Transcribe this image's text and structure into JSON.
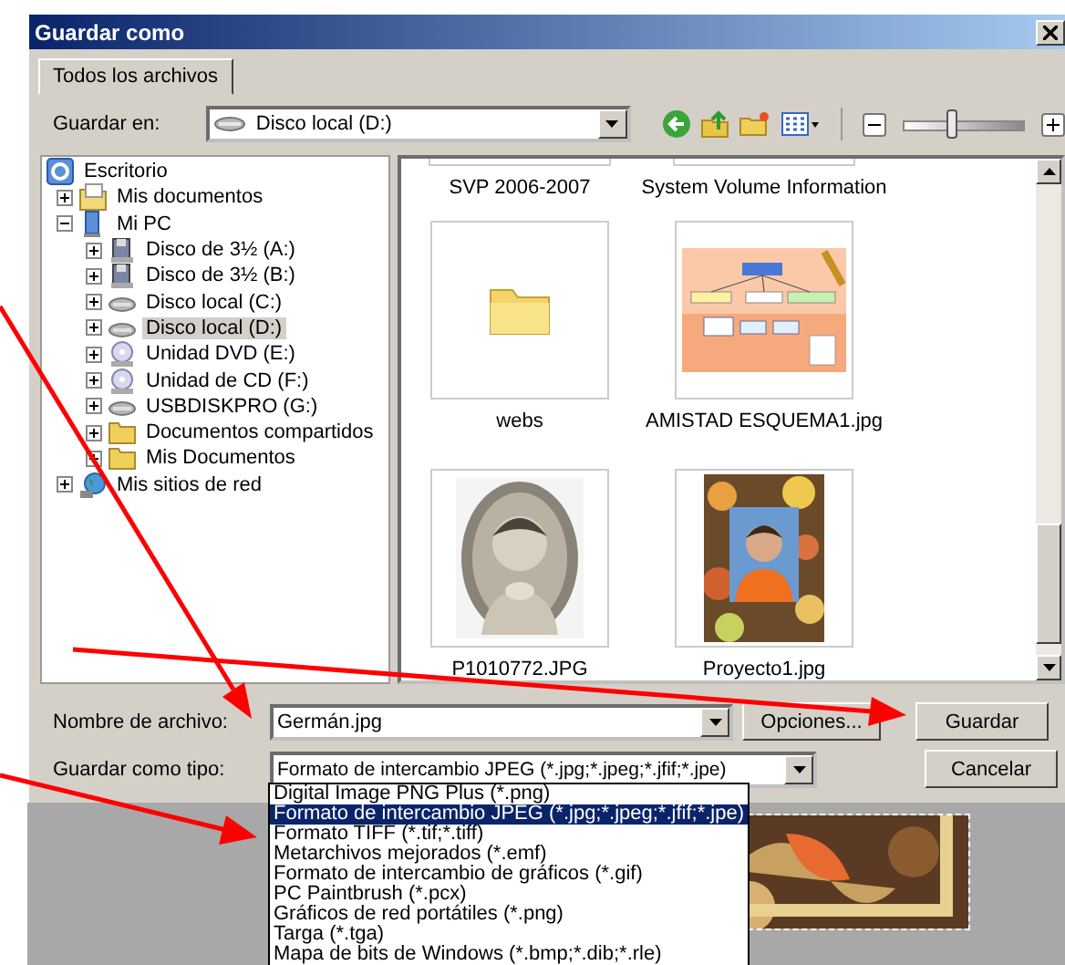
{
  "window": {
    "title": "Guardar como"
  },
  "tabs": [
    {
      "label": "Todos los archivos",
      "selected": true
    }
  ],
  "toolbar": {
    "label": "Guardar en:",
    "location": "Disco local (D:)",
    "zoom": {
      "level": 0.4
    }
  },
  "tree": {
    "root": {
      "label": "Escritorio",
      "kind": "desktop",
      "selected": false,
      "children": [
        {
          "label": "Mis documentos",
          "kind": "documents",
          "expanded": false,
          "selected": false
        },
        {
          "label": "Mi PC",
          "kind": "computer",
          "expanded": true,
          "selected": false,
          "children": [
            {
              "label": "Disco de 3½ (A:)",
              "kind": "floppy",
              "expanded": false,
              "selected": false
            },
            {
              "label": "Disco de 3½ (B:)",
              "kind": "floppy",
              "expanded": false,
              "selected": false
            },
            {
              "label": "Disco local (C:)",
              "kind": "drive",
              "expanded": false,
              "selected": false
            },
            {
              "label": "Disco local (D:)",
              "kind": "drive",
              "expanded": false,
              "selected": true
            },
            {
              "label": "Unidad DVD (E:)",
              "kind": "disc",
              "expanded": false,
              "selected": false
            },
            {
              "label": "Unidad de CD (F:)",
              "kind": "disc",
              "expanded": false,
              "selected": false
            },
            {
              "label": "USBDISKPRO (G:)",
              "kind": "drive",
              "expanded": false,
              "selected": false
            },
            {
              "label": "Documentos compartidos",
              "kind": "folder",
              "expanded": false,
              "selected": false
            },
            {
              "label": "Mis Documentos",
              "kind": "folder",
              "expanded": false,
              "selected": false
            }
          ]
        },
        {
          "label": "Mis sitios de red",
          "kind": "network",
          "expanded": false,
          "selected": false
        }
      ]
    }
  },
  "files": [
    {
      "name": "SVP 2006-2007",
      "kind": "cut"
    },
    {
      "name": "System Volume Information",
      "kind": "cut"
    },
    {
      "name": "webs",
      "kind": "folder"
    },
    {
      "name": "AMISTAD ESQUEMA1.jpg",
      "kind": "diagram"
    },
    {
      "name": "P1010772.JPG",
      "kind": "portrait"
    },
    {
      "name": "Proyecto1.jpg",
      "kind": "framed"
    }
  ],
  "filename": {
    "label": "Nombre de archivo:",
    "value": "Germán.jpg"
  },
  "filetype": {
    "label": "Guardar como tipo:",
    "value": "Formato de intercambio JPEG (*.jpg;*.jpeg;*.jfif;*.jpe)",
    "options": [
      {
        "label": "Digital Image PNG Plus (*.png)",
        "selected": false
      },
      {
        "label": "Formato de intercambio JPEG (*.jpg;*.jpeg;*.jfif;*.jpe)",
        "selected": true
      },
      {
        "label": "Formato TIFF (*.tif;*.tiff)",
        "selected": false
      },
      {
        "label": "Metarchivos mejorados (*.emf)",
        "selected": false
      },
      {
        "label": "Formato de intercambio de gráficos (*.gif)",
        "selected": false
      },
      {
        "label": "PC Paintbrush (*.pcx)",
        "selected": false
      },
      {
        "label": "Gráficos de red portátiles (*.png)",
        "selected": false
      },
      {
        "label": "Targa (*.tga)",
        "selected": false
      },
      {
        "label": "Mapa de bits de Windows (*.bmp;*.dib;*.rle)",
        "selected": false
      }
    ]
  },
  "buttons": {
    "options": "Opciones...",
    "save": "Guardar",
    "cancel": "Cancelar"
  }
}
